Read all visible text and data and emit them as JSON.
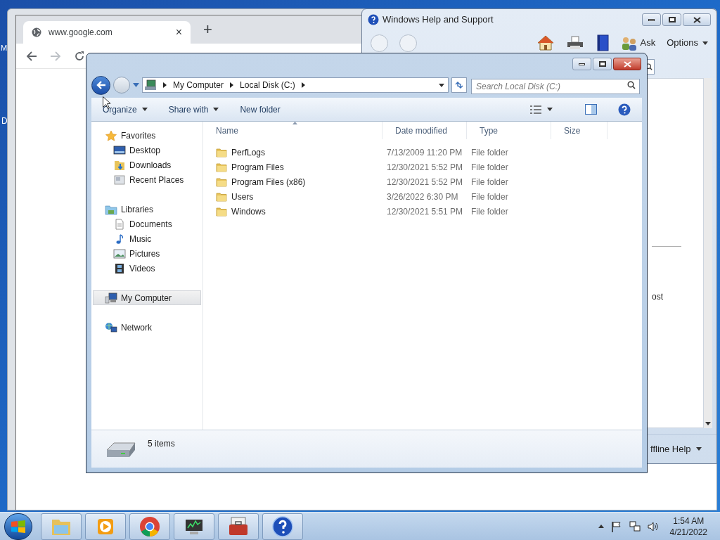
{
  "desktop": {
    "icon_labels": [
      "M",
      "D"
    ]
  },
  "browser": {
    "tab_title": "www.google.com",
    "tab_close": "×",
    "new_tab": "+"
  },
  "help_window": {
    "title": "Windows Help and Support",
    "ask": "Ask",
    "options": "Options",
    "content_text": "ost",
    "footer": "ffline Help"
  },
  "explorer": {
    "breadcrumb": [
      "My Computer",
      "Local Disk (C:)"
    ],
    "search": {
      "placeholder": "Search Local Disk (C:)"
    },
    "commands": [
      {
        "label": "Organize",
        "dropdown": true
      },
      {
        "label": "Share with",
        "dropdown": true
      },
      {
        "label": "New folder",
        "dropdown": false
      }
    ],
    "nav": [
      {
        "label": "Favorites",
        "kind": "favorites",
        "selected": false,
        "children": [
          {
            "label": "Desktop",
            "kind": "desktop",
            "selected": false
          },
          {
            "label": "Downloads",
            "kind": "downloads",
            "selected": false
          },
          {
            "label": "Recent Places",
            "kind": "recent",
            "selected": false
          }
        ]
      },
      {
        "label": "Libraries",
        "kind": "libraries",
        "selected": false,
        "children": [
          {
            "label": "Documents",
            "kind": "documents",
            "selected": false
          },
          {
            "label": "Music",
            "kind": "music",
            "selected": false
          },
          {
            "label": "Pictures",
            "kind": "pictures",
            "selected": false
          },
          {
            "label": "Videos",
            "kind": "videos",
            "selected": false
          }
        ]
      },
      {
        "label": "My Computer",
        "kind": "computer",
        "selected": true
      },
      {
        "label": "Network",
        "kind": "network",
        "selected": false
      }
    ],
    "columns": [
      {
        "label": "Name",
        "sorted": true
      },
      {
        "label": "Date modified",
        "sorted": false
      },
      {
        "label": "Type",
        "sorted": false
      },
      {
        "label": "Size",
        "sorted": false
      }
    ],
    "rows": [
      {
        "name": "PerfLogs",
        "date": "7/13/2009 11:20 PM",
        "type": "File folder"
      },
      {
        "name": "Program Files",
        "date": "12/30/2021 5:52 PM",
        "type": "File folder"
      },
      {
        "name": "Program Files (x86)",
        "date": "12/30/2021 5:52 PM",
        "type": "File folder"
      },
      {
        "name": "Users",
        "date": "3/26/2022 6:30 PM",
        "type": "File folder"
      },
      {
        "name": "Windows",
        "date": "12/30/2021 5:51 PM",
        "type": "File folder"
      }
    ],
    "status": "5 items"
  },
  "taskbar": {
    "apps": [
      {
        "kind": "explorer"
      },
      {
        "kind": "media"
      },
      {
        "kind": "chrome"
      },
      {
        "kind": "monitor"
      },
      {
        "kind": "toolbox"
      },
      {
        "kind": "help"
      }
    ],
    "time": "1:54 AM",
    "date": "4/21/2022"
  }
}
